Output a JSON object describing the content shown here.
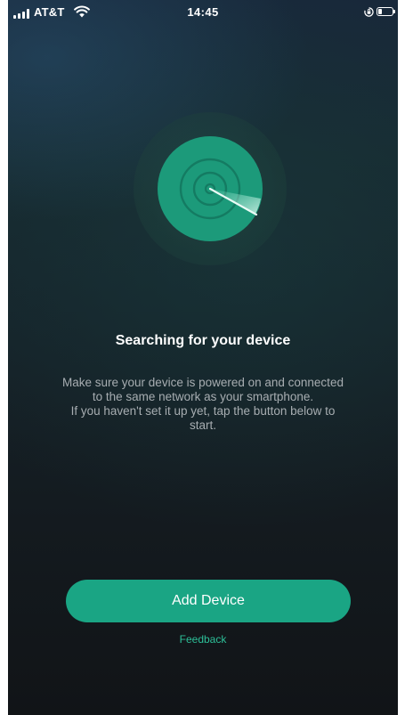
{
  "status_bar": {
    "carrier": "AT&T",
    "time": "14:45",
    "signal_bars": 4,
    "battery_level": 0.25,
    "icons": [
      "signal-icon",
      "wifi-icon",
      "orientation-lock-icon",
      "battery-icon"
    ]
  },
  "main": {
    "title": "Searching for your device",
    "description_lines": [
      "Make sure your device is powered on and connected",
      "to the same network as your smartphone.",
      "If you haven't set it up yet, tap the button below to",
      "start."
    ],
    "add_button_label": "Add Device",
    "feedback_label": "Feedback"
  },
  "colors": {
    "accent": "#1aa584",
    "radar": "#1c9a7a",
    "link": "#2dbf98",
    "text_primary": "#ffffff",
    "text_secondary": "#a7adb1"
  }
}
